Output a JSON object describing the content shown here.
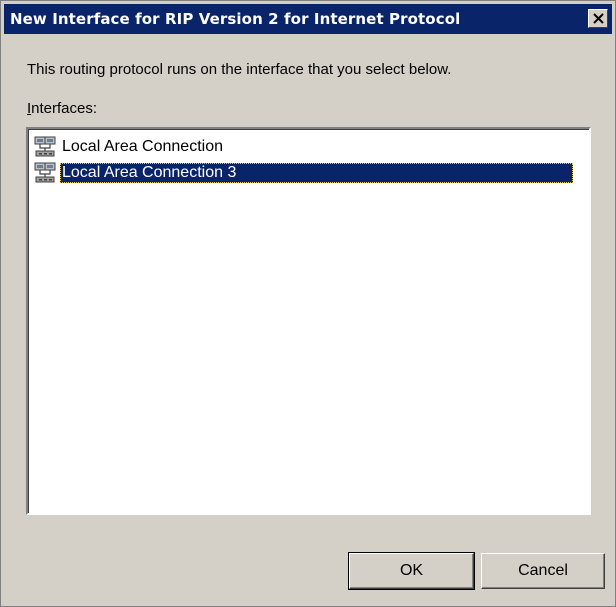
{
  "dialog": {
    "title": "New Interface for RIP Version 2 for Internet Protocol",
    "close_icon": "close-icon",
    "description": "This routing protocol runs on the interface that you select below.",
    "interfaces_label_accel": "I",
    "interfaces_label_rest": "nterfaces:",
    "interfaces": [
      {
        "label": "Local Area Connection",
        "icon": "network-connection-icon",
        "selected": false
      },
      {
        "label": "Local Area Connection 3",
        "icon": "network-connection-icon",
        "selected": true
      }
    ],
    "buttons": {
      "ok_label": "OK",
      "cancel_label": "Cancel"
    }
  },
  "colors": {
    "titlebar": "#0a246a",
    "selection": "#0a246a",
    "dialog_face": "#d4d0c8"
  }
}
